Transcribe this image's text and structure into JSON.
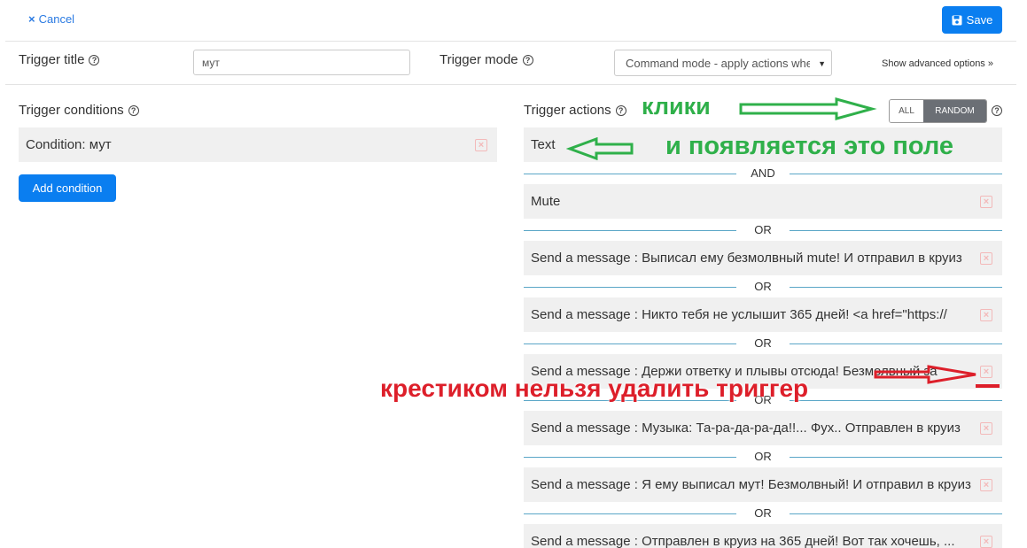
{
  "header": {
    "cancel_label": "Cancel",
    "save_label": "Save"
  },
  "form": {
    "trigger_title_label": "Trigger title",
    "trigger_title_value": "мут",
    "trigger_mode_label": "Trigger mode",
    "trigger_mode_value": "Command mode - apply actions when",
    "advanced_options_label": "Show advanced options »"
  },
  "conditions": {
    "label": "Trigger conditions",
    "items": [
      "Condition: мут"
    ],
    "add_button_label": "Add condition"
  },
  "actions": {
    "label": "Trigger actions",
    "toggle_all": "ALL",
    "toggle_random": "RANDOM",
    "items": [
      "Text",
      "Mute",
      "Send a message : Выписал ему безмолвный mute! И отправил в круиз",
      "Send a message : Никто тебя не услышит 365 дней! <a href=\"https://",
      "Send a message : Держи ответку и плывы отсюда! Безмолвный за",
      "Send a message : Музыка: Та-ра-да-ра-да!!... Фух.. Отправлен в круиз",
      "Send a message : Я ему выписал мут! Безмолвный! И отправил в круиз",
      "Send a message : Отправлен в круиз на 365 дней! Вот так хочешь, ..."
    ],
    "separators": [
      "AND",
      "OR",
      "OR",
      "OR",
      "OR",
      "OR",
      "OR"
    ]
  },
  "annotations": {
    "clicks": "клики",
    "field_appears": "и появляется это поле",
    "cannot_delete": "крестиком нельзя удалить триггер",
    "green_color": "#2fb04a",
    "red_color": "#dd1f2a"
  },
  "colors": {
    "primary": "#0a7ef0",
    "row_bg": "#f0f0f0",
    "separator_line": "#5aa6c7",
    "remove_icon": "#f3b9b9"
  }
}
